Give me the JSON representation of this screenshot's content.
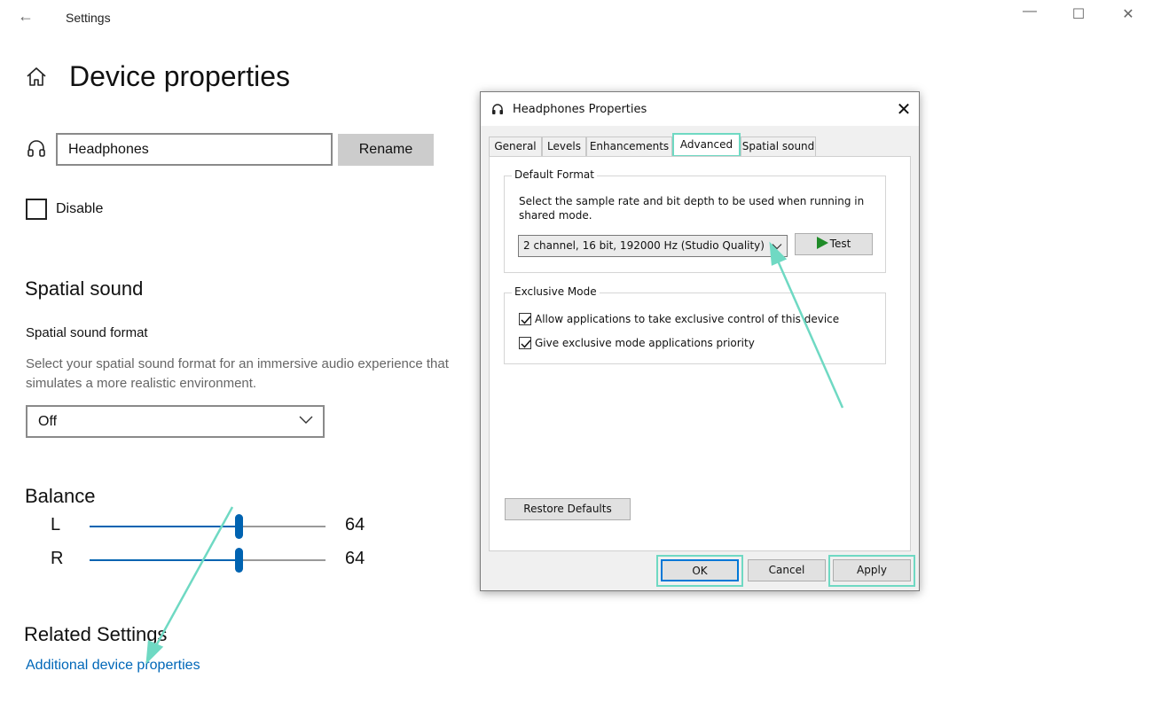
{
  "window": {
    "title": "Settings",
    "back_icon": "back-arrow-icon",
    "minimize_glyph": "—",
    "maximize_glyph": "☐",
    "close_glyph": "✕"
  },
  "page": {
    "title": "Device properties",
    "device_name_value": "Headphones",
    "rename_label": "Rename",
    "disable_label": "Disable",
    "disable_checked": false
  },
  "spatial": {
    "heading": "Spatial sound",
    "format_label": "Spatial sound format",
    "description": "Select your spatial sound format for an immersive audio experience that simulates a more realistic environment.",
    "selected_value": "Off"
  },
  "balance": {
    "heading": "Balance",
    "left_label": "L",
    "left_value": "64",
    "right_label": "R",
    "right_value": "64"
  },
  "related": {
    "heading": "Related Settings",
    "link_label": "Additional device properties"
  },
  "dialog": {
    "title": "Headphones Properties",
    "close_glyph": "✕",
    "tabs": [
      {
        "label": "General"
      },
      {
        "label": "Levels"
      },
      {
        "label": "Enhancements"
      },
      {
        "label": "Advanced"
      },
      {
        "label": "Spatial sound"
      }
    ],
    "active_tab": "Advanced",
    "default_format": {
      "group_label": "Default Format",
      "description": "Select the sample rate and bit depth to be used when running in shared mode.",
      "selected_format": "2 channel, 16 bit, 192000 Hz (Studio Quality)",
      "test_label": "Test"
    },
    "exclusive_mode": {
      "group_label": "Exclusive Mode",
      "allow_label": "Allow applications to take exclusive control of this device",
      "allow_checked": true,
      "priority_label": "Give exclusive mode applications priority",
      "priority_checked": true
    },
    "restore_defaults_label": "Restore Defaults",
    "ok_label": "OK",
    "cancel_label": "Cancel",
    "apply_label": "Apply"
  },
  "colors": {
    "accent": "#0063b1",
    "link": "#0067b8",
    "annotation": "#6fd9c3"
  }
}
